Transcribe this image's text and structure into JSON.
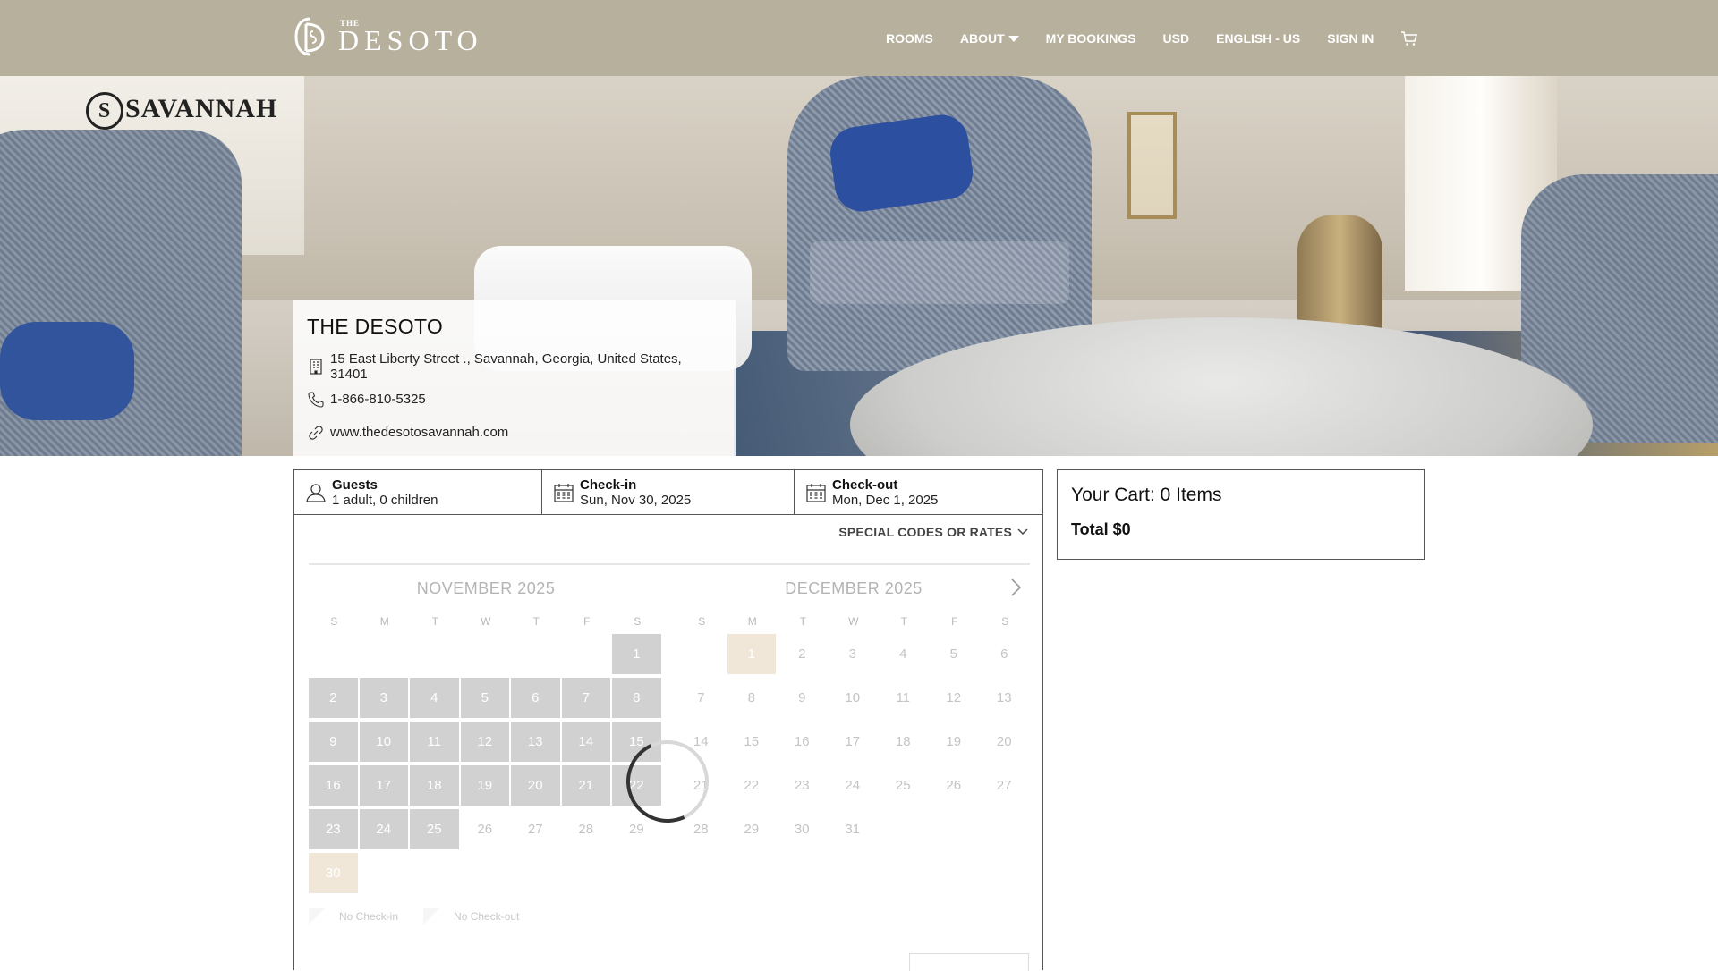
{
  "header": {
    "logo_the": "THE",
    "logo_name": "DESOTO",
    "nav": [
      {
        "label": "ROOMS"
      },
      {
        "label": "ABOUT"
      },
      {
        "label": "MY BOOKINGS"
      },
      {
        "label": "USD"
      },
      {
        "label": "ENGLISH - US"
      },
      {
        "label": "SIGN IN"
      }
    ]
  },
  "hero": {
    "sign_mark": "S",
    "sign_text": "SAVANNAH"
  },
  "hotel": {
    "name": "THE DESOTO",
    "address": "15 East Liberty Street ., Savannah, Georgia, United States, 31401",
    "phone": "1-866-810-5325",
    "website": "www.thedesotosavannah.com"
  },
  "search": {
    "guests_label": "Guests",
    "guests_value": "1 adult, 0 children",
    "checkin_label": "Check-in",
    "checkin_value": "Sun, Nov 30, 2025",
    "checkout_label": "Check-out",
    "checkout_value": "Mon, Dec 1, 2025",
    "special_codes": "SPECIAL CODES OR RATES"
  },
  "calendar": {
    "weekdays": [
      "S",
      "M",
      "T",
      "W",
      "T",
      "F",
      "S"
    ],
    "months": [
      {
        "title": "NOVEMBER 2025",
        "weeks": [
          [
            null,
            null,
            null,
            null,
            null,
            null,
            1
          ],
          [
            2,
            3,
            4,
            5,
            6,
            7,
            8
          ],
          [
            9,
            10,
            11,
            12,
            13,
            14,
            15
          ],
          [
            16,
            17,
            18,
            19,
            20,
            21,
            22
          ],
          [
            23,
            24,
            25,
            26,
            27,
            28,
            29
          ],
          [
            30,
            null,
            null,
            null,
            null,
            null,
            null
          ]
        ],
        "past_through": 25,
        "selected": 30
      },
      {
        "title": "DECEMBER 2025",
        "weeks": [
          [
            null,
            1,
            2,
            3,
            4,
            5,
            6
          ],
          [
            7,
            8,
            9,
            10,
            11,
            12,
            13
          ],
          [
            14,
            15,
            16,
            17,
            18,
            19,
            20
          ],
          [
            21,
            22,
            23,
            24,
            25,
            26,
            27
          ],
          [
            28,
            29,
            30,
            31,
            null,
            null,
            null
          ]
        ],
        "past_through": 0,
        "selected": 1
      }
    ],
    "legend": {
      "no_checkin": "No Check-in",
      "no_checkout": "No Check-out"
    }
  },
  "cart": {
    "title": "Your Cart: 0 Items",
    "total": "Total $0"
  },
  "colors": {
    "header_bg": "#b7b09d",
    "past_day": "#d1d1d1",
    "selected_day": "#f0e7d8"
  }
}
